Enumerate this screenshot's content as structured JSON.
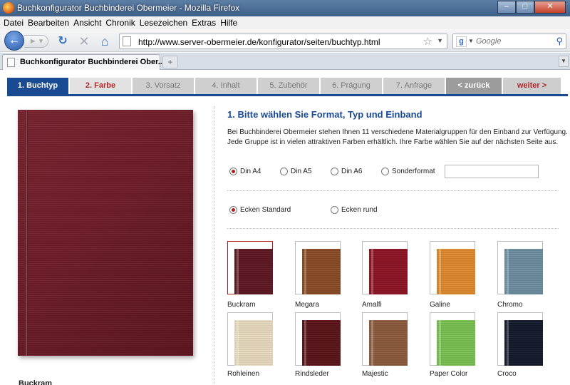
{
  "window": {
    "title": "Buchkonfigurator Buchbinderei Obermeier - Mozilla Firefox"
  },
  "menu": [
    "Datei",
    "Bearbeiten",
    "Ansicht",
    "Chronik",
    "Lesezeichen",
    "Extras",
    "Hilfe"
  ],
  "navbar": {
    "url": "http://www.server-obermeier.de/konfigurator/seiten/buchtyp.html",
    "search_placeholder": "Google"
  },
  "tab": {
    "label": "Buchkonfigurator Buchbinderei Ober...",
    "new_tab": "+"
  },
  "steps": [
    {
      "label": "1. Buchtyp"
    },
    {
      "label": "2. Farbe"
    },
    {
      "label": "3. Vorsatz"
    },
    {
      "label": "4. Inhalt"
    },
    {
      "label": "5. Zubehör"
    },
    {
      "label": "6. Prägung"
    },
    {
      "label": "7. Anfrage"
    },
    {
      "label": "< zurück"
    },
    {
      "label": "weiter >"
    }
  ],
  "preview": {
    "caption": "Buckram"
  },
  "content": {
    "heading": "1. Bitte wählen Sie Format, Typ und Einband",
    "intro_line1": "Bei Buchbinderei Obermeier stehen Ihnen 11 verschiedene Materialgruppen für den Einband zur Verfügung.",
    "intro_line2": "Jede Gruppe ist in vielen attraktiven Farben erhältlich. Ihre Farbe wählen Sie auf der nächsten Seite aus."
  },
  "formats": [
    {
      "label": "Din A4",
      "selected": true
    },
    {
      "label": "Din A5",
      "selected": false
    },
    {
      "label": "Din A6",
      "selected": false
    },
    {
      "label": "Sonderformat",
      "selected": false
    }
  ],
  "corners": [
    {
      "label": "Ecken Standard",
      "selected": true
    },
    {
      "label": "Ecken rund",
      "selected": false
    }
  ],
  "materials": [
    {
      "name": "Buckram",
      "color": "#5e1722",
      "selected": true
    },
    {
      "name": "Megara",
      "color": "#8a4b26",
      "selected": false
    },
    {
      "name": "Amalfi",
      "color": "#8d1424",
      "selected": false
    },
    {
      "name": "Galine",
      "color": "#e08a2c",
      "selected": false
    },
    {
      "name": "Chromo",
      "color": "#6c8ea0",
      "selected": false
    },
    {
      "name": "Rohleinen",
      "color": "#e9dcbf",
      "selected": false
    },
    {
      "name": "Rindsleder",
      "color": "#5a1418",
      "selected": false
    },
    {
      "name": "Majestic",
      "color": "#8c5a3c",
      "selected": false
    },
    {
      "name": "Paper Color",
      "color": "#79c151",
      "selected": false
    },
    {
      "name": "Croco",
      "color": "#141a2c",
      "selected": false
    }
  ]
}
